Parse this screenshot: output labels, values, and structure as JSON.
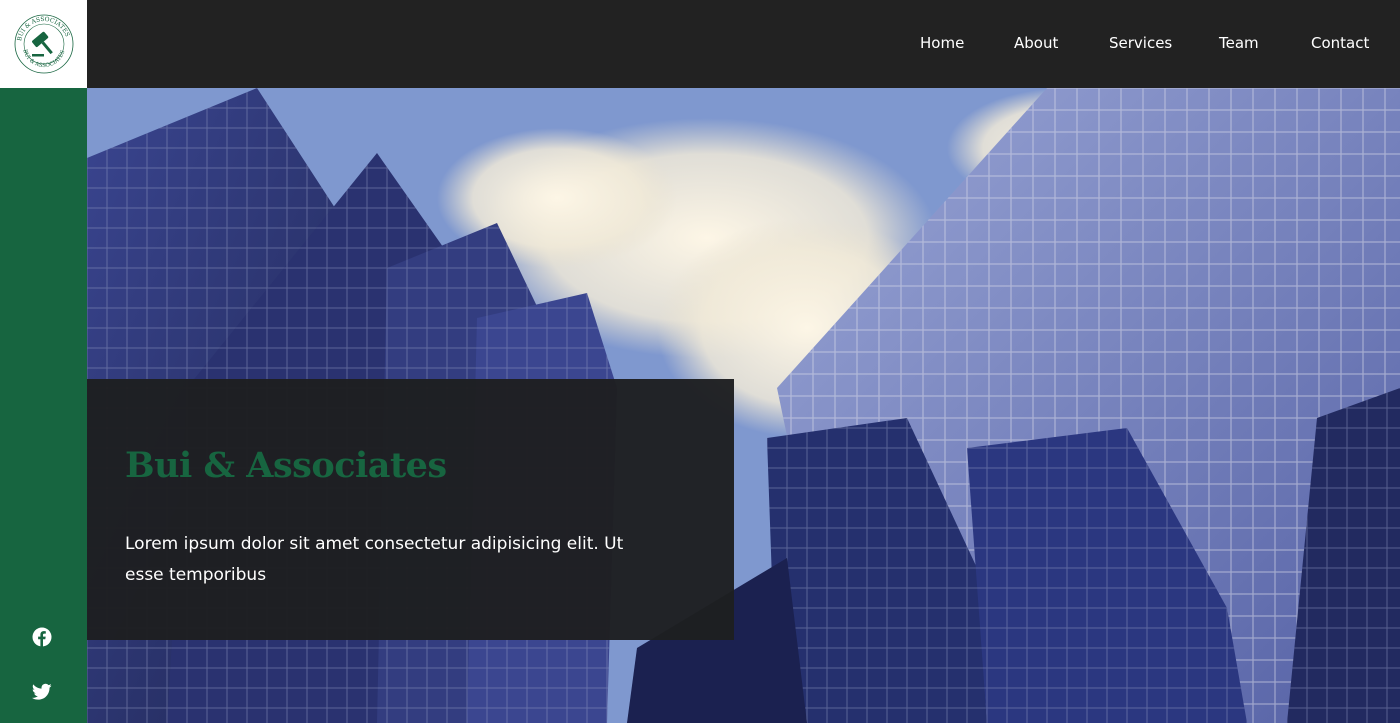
{
  "brand": {
    "logo_icon": "gavel-seal-icon",
    "logo_text": "BUI & ASSOCIATES",
    "accent_color": "#176540",
    "header_bg": "#222222",
    "card_bg": "#1e1f21"
  },
  "nav": {
    "items": [
      {
        "label": "Home"
      },
      {
        "label": "About"
      },
      {
        "label": "Services"
      },
      {
        "label": "Team"
      },
      {
        "label": "Contact"
      }
    ]
  },
  "hero": {
    "image": "glass-skyscrapers-photo",
    "title": "Bui & Associates",
    "text": "Lorem ipsum dolor sit amet consectetur adipisicing elit. Ut esse temporibus"
  },
  "social": [
    {
      "icon": "facebook-icon"
    },
    {
      "icon": "twitter-icon"
    }
  ]
}
